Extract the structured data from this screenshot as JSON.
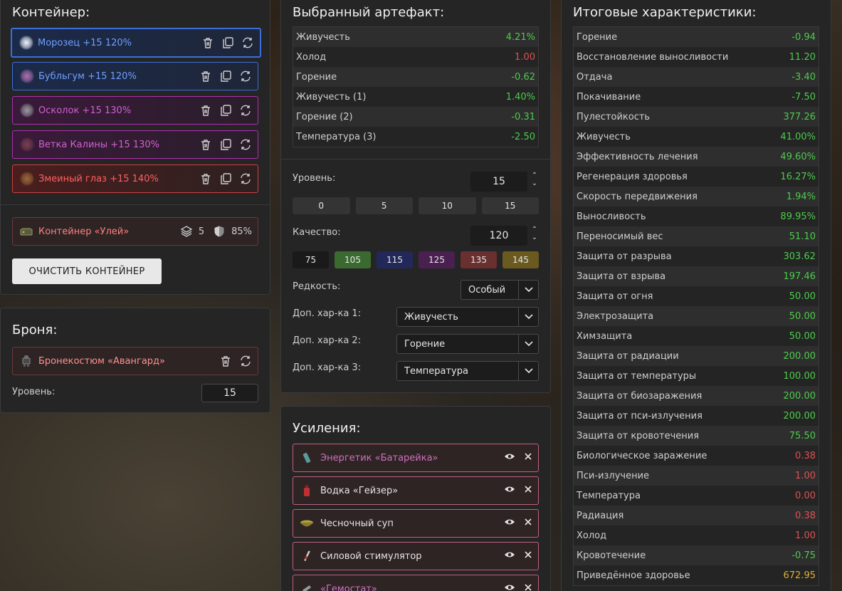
{
  "container": {
    "title": "Контейнер:",
    "artifacts": [
      {
        "label": "Морозец +15 120%",
        "color": "blue",
        "icon": "white-orb-icon"
      },
      {
        "label": "Бубльгум +15 120%",
        "color": "blue",
        "icon": "pink-cluster-icon"
      },
      {
        "label": "Осколок +15 130%",
        "color": "purple",
        "icon": "shard-icon"
      },
      {
        "label": "Ветка Калины +15 130%",
        "color": "purple",
        "icon": "branch-icon"
      },
      {
        "label": "Змеиный глаз +15 140%",
        "color": "red",
        "icon": "snake-eye-icon"
      }
    ],
    "container_item": {
      "label": "Контейнер «Улей»",
      "slots": "5",
      "protection": "85%"
    },
    "clear_button": "ОЧИСТИТЬ КОНТЕЙНЕР"
  },
  "armor": {
    "title": "Броня:",
    "item": "Бронекостюм «Авангард»",
    "level_label": "Уровень:",
    "level_value": "15"
  },
  "selected": {
    "title": "Выбранный артефакт:",
    "stats": [
      {
        "name": "Живучесть",
        "value": "4.21%",
        "tone": "green"
      },
      {
        "name": "Холод",
        "value": "1.00",
        "tone": "red"
      },
      {
        "name": "Горение",
        "value": "-0.62",
        "tone": "green"
      },
      {
        "name": "Живучесть (1)",
        "value": "1.40%",
        "tone": "green"
      },
      {
        "name": "Горение (2)",
        "value": "-0.31",
        "tone": "green"
      },
      {
        "name": "Температура (3)",
        "value": "-2.50",
        "tone": "green"
      }
    ],
    "level_label": "Уровень:",
    "level_value": "15",
    "level_presets": [
      "0",
      "5",
      "10",
      "15"
    ],
    "quality_label": "Качество:",
    "quality_value": "120",
    "quality_presets": [
      {
        "label": "75",
        "color": "#1a1a1a"
      },
      {
        "label": "105",
        "color": "#3a6a30"
      },
      {
        "label": "115",
        "color": "#22285a"
      },
      {
        "label": "125",
        "color": "#4a2050"
      },
      {
        "label": "135",
        "color": "#6a3030"
      },
      {
        "label": "145",
        "color": "#6a5a20"
      }
    ],
    "rarity_label": "Редкость:",
    "rarity_value": "Особый",
    "extra1_label": "Доп. хар-ка 1:",
    "extra1_value": "Живучесть",
    "extra2_label": "Доп. хар-ка 2:",
    "extra2_value": "Горение",
    "extra3_label": "Доп. хар-ка 3:",
    "extra3_value": "Температура"
  },
  "boosts": {
    "title": "Усиления:",
    "items": [
      {
        "label": "Энергетик «Батарейка»",
        "color": "#d070c0"
      },
      {
        "label": "Водка «Гейзер»",
        "color": "#e6e6e6"
      },
      {
        "label": "Чесночный суп",
        "color": "#e6e6e6"
      },
      {
        "label": "Силовой стимулятор",
        "color": "#e6e6e6"
      },
      {
        "label": "«Гемостат»",
        "color": "#d070c0"
      }
    ]
  },
  "totals": {
    "title": "Итоговые характеристики:",
    "stats": [
      {
        "name": "Горение",
        "value": "-0.94",
        "tone": "green"
      },
      {
        "name": "Восстановление выносливости",
        "value": "11.20",
        "tone": "green"
      },
      {
        "name": "Отдача",
        "value": "-3.40",
        "tone": "green"
      },
      {
        "name": "Покачивание",
        "value": "-7.50",
        "tone": "green"
      },
      {
        "name": "Пулестойкость",
        "value": "377.26",
        "tone": "green"
      },
      {
        "name": "Живучесть",
        "value": "41.00%",
        "tone": "green"
      },
      {
        "name": "Эффективность лечения",
        "value": "49.60%",
        "tone": "green"
      },
      {
        "name": "Регенерация здоровья",
        "value": "16.27%",
        "tone": "green"
      },
      {
        "name": "Скорость передвижения",
        "value": "1.94%",
        "tone": "green"
      },
      {
        "name": "Выносливость",
        "value": "89.95%",
        "tone": "green"
      },
      {
        "name": "Переносимый вес",
        "value": "51.10",
        "tone": "green"
      },
      {
        "name": "Защита от разрыва",
        "value": "303.62",
        "tone": "green"
      },
      {
        "name": "Защита от взрыва",
        "value": "197.46",
        "tone": "green"
      },
      {
        "name": "Защита от огня",
        "value": "50.00",
        "tone": "green"
      },
      {
        "name": "Электрозащита",
        "value": "50.00",
        "tone": "green"
      },
      {
        "name": "Химзащита",
        "value": "50.00",
        "tone": "green"
      },
      {
        "name": "Защита от радиации",
        "value": "200.00",
        "tone": "green"
      },
      {
        "name": "Защита от температуры",
        "value": "100.00",
        "tone": "green"
      },
      {
        "name": "Защита от биозаражения",
        "value": "200.00",
        "tone": "green"
      },
      {
        "name": "Защита от пси-излучения",
        "value": "200.00",
        "tone": "green"
      },
      {
        "name": "Защита от кровотечения",
        "value": "75.50",
        "tone": "green"
      },
      {
        "name": "Биологическое заражение",
        "value": "0.38",
        "tone": "red"
      },
      {
        "name": "Пси-излучение",
        "value": "1.00",
        "tone": "red"
      },
      {
        "name": "Температура",
        "value": "0.00",
        "tone": "red"
      },
      {
        "name": "Радиация",
        "value": "0.38",
        "tone": "red"
      },
      {
        "name": "Холод",
        "value": "1.00",
        "tone": "red"
      },
      {
        "name": "Кровотечение",
        "value": "-0.75",
        "tone": "green"
      },
      {
        "name": "Приведённое здоровье",
        "value": "672.95",
        "tone": "gold"
      }
    ]
  }
}
